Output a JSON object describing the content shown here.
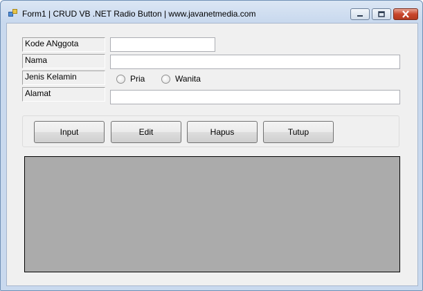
{
  "window": {
    "title": "Form1 | CRUD VB .NET Radio Button | www.javanetmedia.com",
    "controls": [
      "minimize-icon",
      "maximize-icon",
      "close-icon"
    ]
  },
  "form": {
    "labels": {
      "kode": "Kode ANggota",
      "nama": "Nama",
      "jenis_kelamin": "Jenis Kelamin",
      "alamat": "Alamat"
    },
    "inputs": {
      "kode": "",
      "nama": "",
      "alamat": ""
    },
    "radios": {
      "pria": "Pria",
      "wanita": "Wanita"
    }
  },
  "buttons": {
    "input": "Input",
    "edit": "Edit",
    "hapus": "Hapus",
    "tutup": "Tutup"
  }
}
